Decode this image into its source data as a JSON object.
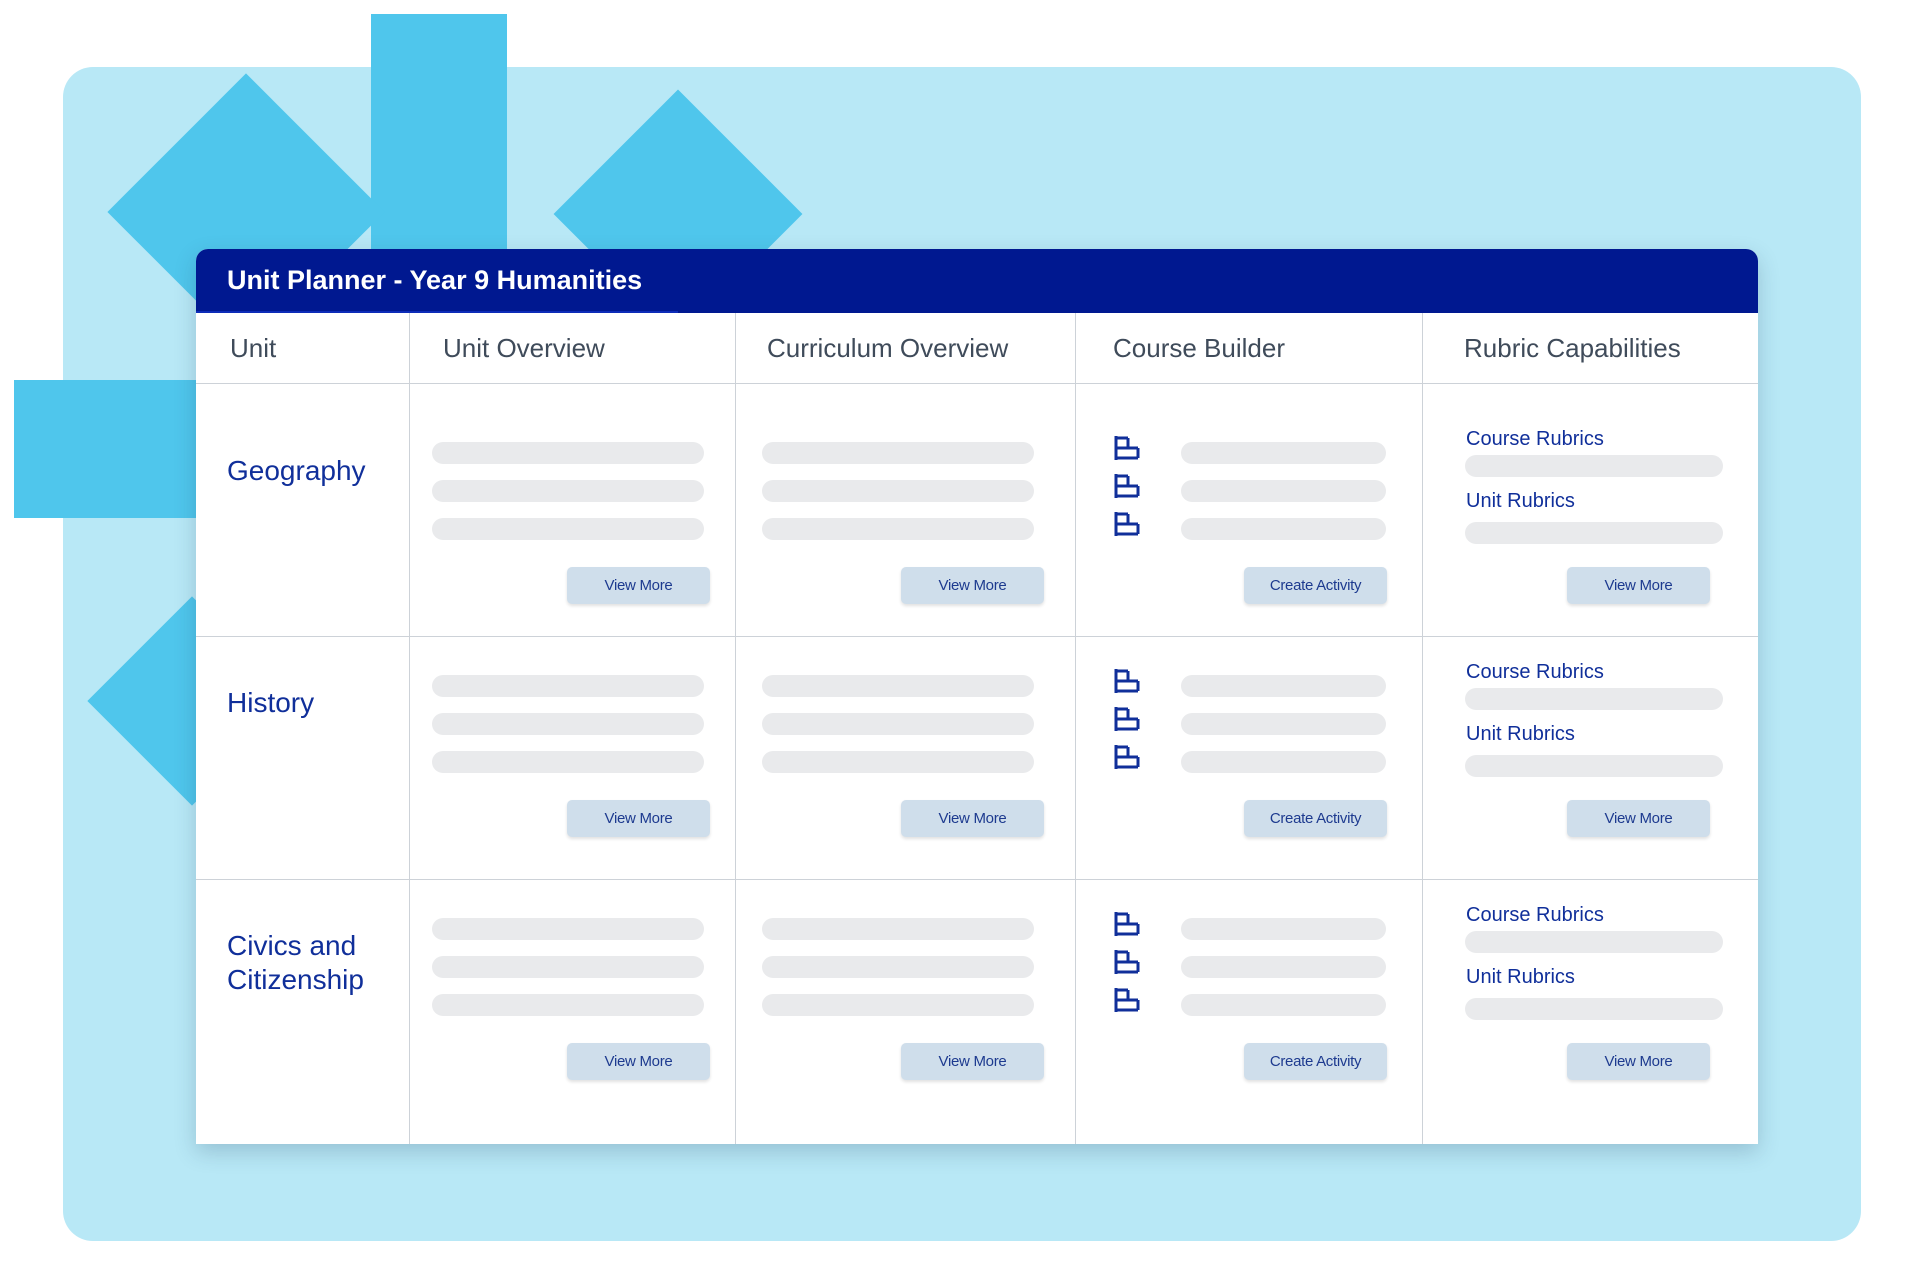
{
  "header": {
    "title": "Unit Planner - Year 9 Humanities"
  },
  "columns": [
    "Unit",
    "Unit Overview",
    "Curriculum Overview",
    "Course Builder",
    "Rubric Capabilities"
  ],
  "units": [
    {
      "name_lines": [
        "Geography"
      ],
      "unit_overview_button": "View More",
      "curriculum_overview_button": "View More",
      "course_builder_button": "Create Activity",
      "rubric_links": [
        "Course Rubrics",
        "Unit Rubrics"
      ],
      "rubric_button": "View More"
    },
    {
      "name_lines": [
        "History"
      ],
      "unit_overview_button": "View More",
      "curriculum_overview_button": "View More",
      "course_builder_button": "Create Activity",
      "rubric_links": [
        "Course Rubrics",
        "Unit Rubrics"
      ],
      "rubric_button": "View More"
    },
    {
      "name_lines": [
        "Civics and",
        "Citizenship"
      ],
      "unit_overview_button": "View More",
      "curriculum_overview_button": "View More",
      "course_builder_button": "Create Activity",
      "rubric_links": [
        "Course Rubrics",
        "Unit Rubrics"
      ],
      "rubric_button": "View More"
    }
  ],
  "icons": {
    "activity": "hierarchy-icon"
  },
  "colors": {
    "header": "#001890",
    "accent_text": "#102f9a",
    "decor": "#4fc6ec",
    "panel": "#b8e8f6"
  }
}
